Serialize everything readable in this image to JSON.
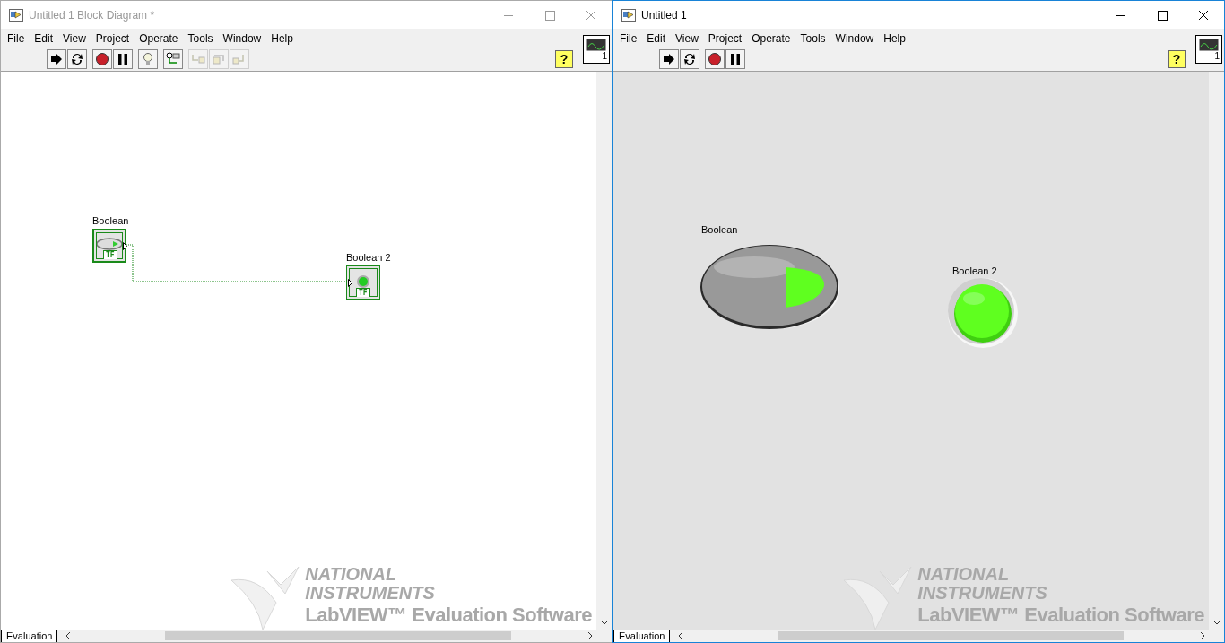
{
  "windows": [
    {
      "kind": "diagram",
      "title": "Untitled 1 Block Diagram *",
      "active": false,
      "menu": [
        "File",
        "Edit",
        "View",
        "Project",
        "Operate",
        "Tools",
        "Window",
        "Help"
      ],
      "toolbar": [
        {
          "kind": "run",
          "disabled": false
        },
        {
          "kind": "run_continuous",
          "disabled": false
        },
        {
          "kind": "abort",
          "disabled": false
        },
        {
          "kind": "pause",
          "disabled": false
        },
        {
          "kind": "highlight",
          "disabled": false
        },
        {
          "kind": "retain",
          "disabled": false
        },
        {
          "kind": "step_into",
          "disabled": true
        },
        {
          "kind": "step_over",
          "disabled": true
        },
        {
          "kind": "step_out",
          "disabled": true
        }
      ],
      "help_label": "?",
      "connector_label": "1",
      "nodes": [
        {
          "kind": "control",
          "label": "Boolean",
          "type_label": "TF",
          "on": true
        },
        {
          "kind": "indicator",
          "label": "Boolean 2",
          "type_label": "TF",
          "on": true
        }
      ],
      "watermark": {
        "line_1": "NATIONAL",
        "line_2": "INSTRUMENTS",
        "line_3": "LabVIEW™ Evaluation Software"
      },
      "status_tab": "Evaluation"
    },
    {
      "kind": "panel",
      "title": "Untitled 1",
      "active": true,
      "menu": [
        "File",
        "Edit",
        "View",
        "Project",
        "Operate",
        "Tools",
        "Window",
        "Help"
      ],
      "toolbar": [
        {
          "kind": "run",
          "disabled": false
        },
        {
          "kind": "run_continuous",
          "disabled": false
        },
        {
          "kind": "abort",
          "disabled": false
        },
        {
          "kind": "pause",
          "disabled": false
        }
      ],
      "help_label": "?",
      "connector_label": "1",
      "nodes": [
        {
          "kind": "control",
          "label": "Boolean",
          "on": true
        },
        {
          "kind": "indicator",
          "label": "Boolean 2",
          "on": true
        }
      ],
      "watermark": {
        "line_1": "NATIONAL",
        "line_2": "INSTRUMENTS",
        "line_3": "LabVIEW™ Evaluation Software"
      },
      "status_tab": "Evaluation"
    }
  ]
}
